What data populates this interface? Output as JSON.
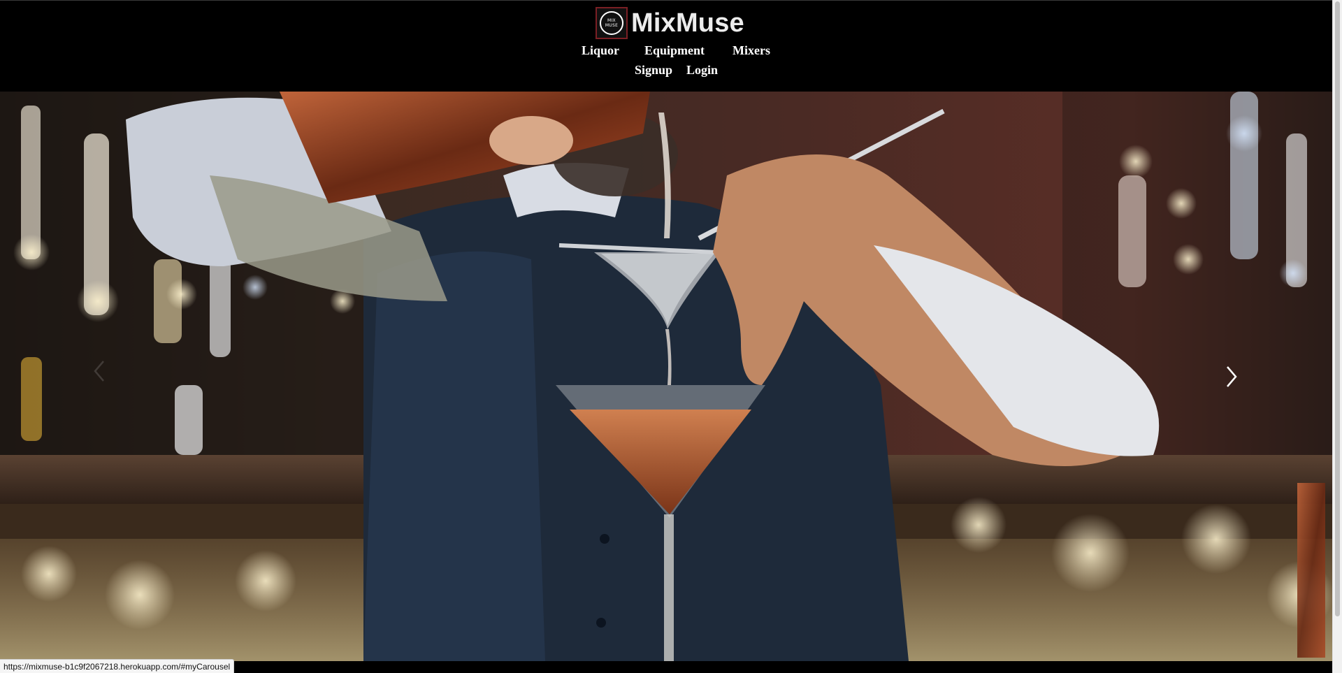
{
  "brand": {
    "name": "MixMuse",
    "logo_text_line1": "MIX",
    "logo_text_line2": "MUSE"
  },
  "nav": {
    "primary": [
      {
        "label": "Liquor"
      },
      {
        "label": "Equipment"
      },
      {
        "label": "Mixers"
      }
    ],
    "secondary": [
      {
        "label": "Signup"
      },
      {
        "label": "Login"
      }
    ]
  },
  "carousel": {
    "image_icon": "bartender-pouring-cocktail-image",
    "prev_icon": "chevron-left-icon",
    "next_icon": "chevron-right-icon"
  },
  "status_bar": {
    "url": "https://mixmuse-b1c9f2067218.herokuapp.com/#myCarousel"
  },
  "colors": {
    "header_bg": "#000000",
    "brand_text": "#ececec",
    "nav_text": "#ffffff",
    "logo_border": "#7a1f24"
  }
}
